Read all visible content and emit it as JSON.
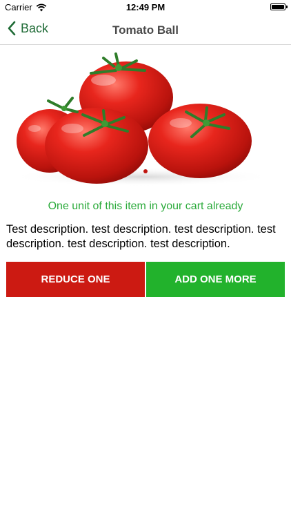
{
  "status_bar": {
    "carrier": "Carrier",
    "time": "12:49 PM",
    "wifi_icon": "wifi-icon",
    "battery_icon": "battery-icon"
  },
  "nav": {
    "back_label": "Back",
    "back_icon": "chevron-left-icon",
    "title": "Tomato Ball"
  },
  "product": {
    "image": "tomato-product-photo",
    "cart_status": "One unit of this item in your cart already",
    "description": "Test description. test description. test description. test description. test description. test description."
  },
  "actions": {
    "reduce_label": "REDUCE ONE",
    "add_label": "ADD ONE MORE"
  },
  "colors": {
    "accent_green": "#1f6b36",
    "status_green": "#2aaa3a",
    "reduce_red": "#cc1a12",
    "add_green": "#22b22c"
  }
}
